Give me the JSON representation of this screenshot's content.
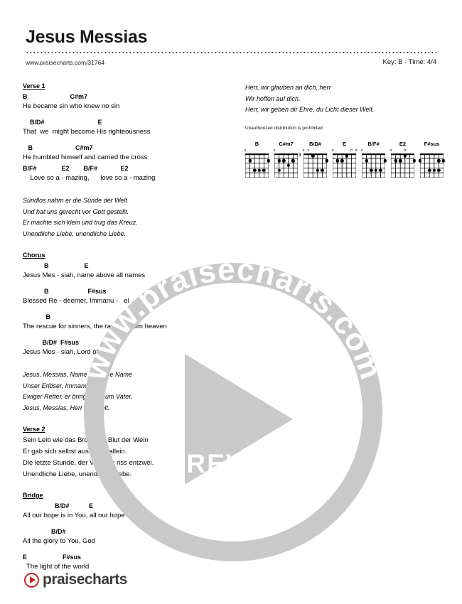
{
  "header": {
    "title": "Jesus Messias",
    "site_url": "www.praisecharts.com/31764",
    "key_time": "Key: B · Time: 4/4"
  },
  "left_column": {
    "verse1": {
      "title": "Verse 1",
      "lines": [
        {
          "chords": "B                        C#m7",
          "lyric": "He became sin who knew no sin"
        },
        {
          "chords": "    B/D#                              E",
          "lyric": "That  we  might become His righteousness"
        },
        {
          "chords": "   B                        C#m7",
          "lyric": "He humbled himself and carried the cross"
        },
        {
          "chords": "B/F#              E2        B/F#             E2",
          "lyric": "    Love so a - mazing,      love so a - mazing"
        }
      ]
    },
    "verse1_translation": [
      "Sündlos nahm er die Sünde der Welt",
      "Und hat uns gerecht vor Gott gestellt.",
      "Er machte sich klein und trug das Kreuz.",
      "Unendliche Liebe, unendliche Liebe."
    ],
    "chorus": {
      "title": "Chorus",
      "lines": [
        {
          "chords": "            B                    E",
          "lyric": "Jesus Mes - siah, name above all names"
        },
        {
          "chords": "            B                      F#sus",
          "lyric": "Blessed Re - deemer, Immanu -   el"
        },
        {
          "chords": "             B",
          "lyric": "The rescue for sinners, the ransom from heaven"
        },
        {
          "chords": "           B/D#  F#sus",
          "lyric": "Jesus Mes - siah, Lord of all"
        }
      ]
    },
    "chorus_translation": [
      "Jesus, Messias, Name über alle Name",
      "Unser Erlöser, Immanuel.",
      "Ewiger Retter, er bringt uns zum Vater.",
      "Jesus, Messias, Herr der Welt."
    ],
    "verse2": {
      "title": "Verse 2",
      "lines": [
        "Sein Leib wie das Brot, sein Blut der Wein",
        "Er gab sich selbst aus Liebe allein.",
        "Die letzte Stunde, der Vorhang riss entzwei.",
        "Unendliche Liebe, unendliche Liebe."
      ]
    },
    "bridge": {
      "title": "Bridge",
      "lines": [
        {
          "chords": "                  B/D#           E",
          "lyric": "All our hope is in You, all our hope is in You"
        },
        {
          "chords": "                B/D#",
          "lyric": "All the glory to You, God"
        },
        {
          "chords": "E                    F#sus",
          "lyric": "  The light of the world"
        }
      ]
    }
  },
  "right_column": {
    "translation": [
      "Herr, wir glauben an dich, herr",
      "Wir hoffen auf dich.",
      "Herr, wir geben dir Ehre, du Licht dieser Welt."
    ],
    "notice": "Unauthorized distribution is prohibited."
  },
  "chords": [
    {
      "name": "B",
      "markers": [
        {
          "text": "x",
          "string": 0
        }
      ],
      "base_fret": "",
      "dots": [
        {
          "string": 1,
          "fret": 2
        },
        {
          "string": 5,
          "fret": 2
        },
        {
          "string": 2,
          "fret": 4
        },
        {
          "string": 3,
          "fret": 4
        },
        {
          "string": 4,
          "fret": 4
        }
      ]
    },
    {
      "name": "C#m7",
      "markers": [
        {
          "text": "x",
          "string": 0
        }
      ],
      "base_fret": "3",
      "dots": [
        {
          "string": 1,
          "fret": 2
        },
        {
          "string": 2,
          "fret": 2
        },
        {
          "string": 4,
          "fret": 2
        },
        {
          "string": 3,
          "fret": 3
        },
        {
          "string": 1,
          "fret": 4
        }
      ]
    },
    {
      "name": "B/D#",
      "markers": [
        {
          "text": "x",
          "string": 0
        },
        {
          "text": "x",
          "string": 1
        }
      ],
      "base_fret": "",
      "dots": [
        {
          "string": 2,
          "fret": 1
        },
        {
          "string": 5,
          "fret": 2
        },
        {
          "string": 3,
          "fret": 4
        },
        {
          "string": 4,
          "fret": 4
        }
      ]
    },
    {
      "name": "E",
      "markers": [
        {
          "text": "o",
          "string": 0
        },
        {
          "text": "o",
          "string": 4
        },
        {
          "text": "o",
          "string": 5
        }
      ],
      "base_fret": "",
      "dots": [
        {
          "string": 3,
          "fret": 1
        },
        {
          "string": 1,
          "fret": 2
        },
        {
          "string": 2,
          "fret": 2
        }
      ]
    },
    {
      "name": "B/F#",
      "markers": [
        {
          "text": "x",
          "string": 0
        }
      ],
      "base_fret": "",
      "dots": [
        {
          "string": 1,
          "fret": 2
        },
        {
          "string": 5,
          "fret": 2
        },
        {
          "string": 2,
          "fret": 4
        },
        {
          "string": 3,
          "fret": 4
        },
        {
          "string": 4,
          "fret": 4
        }
      ]
    },
    {
      "name": "E2",
      "markers": [
        {
          "text": "o",
          "string": 0
        },
        {
          "text": "o",
          "string": 3
        }
      ],
      "base_fret": "",
      "dots": [
        {
          "string": 1,
          "fret": 2
        },
        {
          "string": 2,
          "fret": 2
        },
        {
          "string": 5,
          "fret": 2
        },
        {
          "string": 3,
          "fret": 1
        }
      ]
    },
    {
      "name": "F#sus",
      "markers": [],
      "base_fret": "",
      "dots": [
        {
          "string": 0,
          "fret": 2
        },
        {
          "string": 4,
          "fret": 2
        },
        {
          "string": 5,
          "fret": 2
        },
        {
          "string": 2,
          "fret": 4
        },
        {
          "string": 3,
          "fret": 4
        },
        {
          "string": 4,
          "fret": 4
        }
      ]
    }
  ],
  "watermark": {
    "ring_text": "www.praisecharts.com",
    "preview_label": "PREVIEW",
    "color": "#c9c9c9"
  },
  "footer": {
    "wordmark": "praisecharts",
    "accent_color": "#d62020"
  }
}
